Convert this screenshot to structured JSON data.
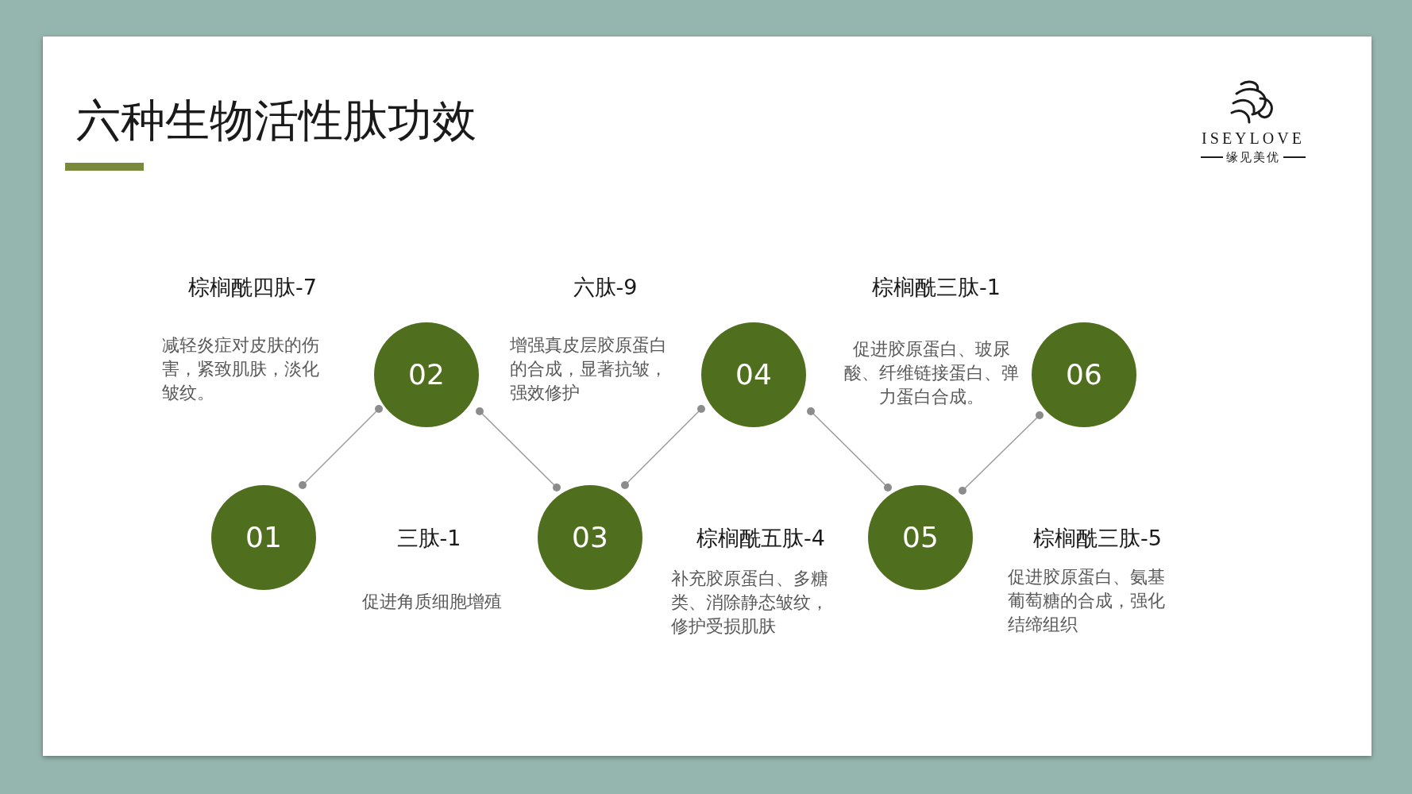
{
  "slide": {
    "title": "六种生物活性肽功效",
    "logo": {
      "brand": "ISEYLOVE",
      "tagline": "缘见美优"
    },
    "steps": [
      {
        "number": "01",
        "name": "棕榈酰四肽-7",
        "description": "减轻炎症对皮肤的伤害，紧致肌肤，淡化皱纹。"
      },
      {
        "number": "02",
        "name": "三肽-1",
        "description": "促进角质细胞增殖"
      },
      {
        "number": "03",
        "name": "六肽-9",
        "description": "增强真皮层胶原蛋白的合成，显著抗皱，强效修护"
      },
      {
        "number": "04",
        "name": "棕榈酰五肽-4",
        "description": "补充胶原蛋白、多糖类、消除静态皱纹，修护受损肌肤"
      },
      {
        "number": "05",
        "name": "棕榈酰三肽-1",
        "description": "促进胶原蛋白、玻尿酸、纤维链接蛋白、弹力蛋白合成。"
      },
      {
        "number": "06",
        "name": "棕榈酰三肽-5",
        "description": "促进胶原蛋白、氨基葡萄糖的合成，强化结缔组织"
      }
    ]
  }
}
